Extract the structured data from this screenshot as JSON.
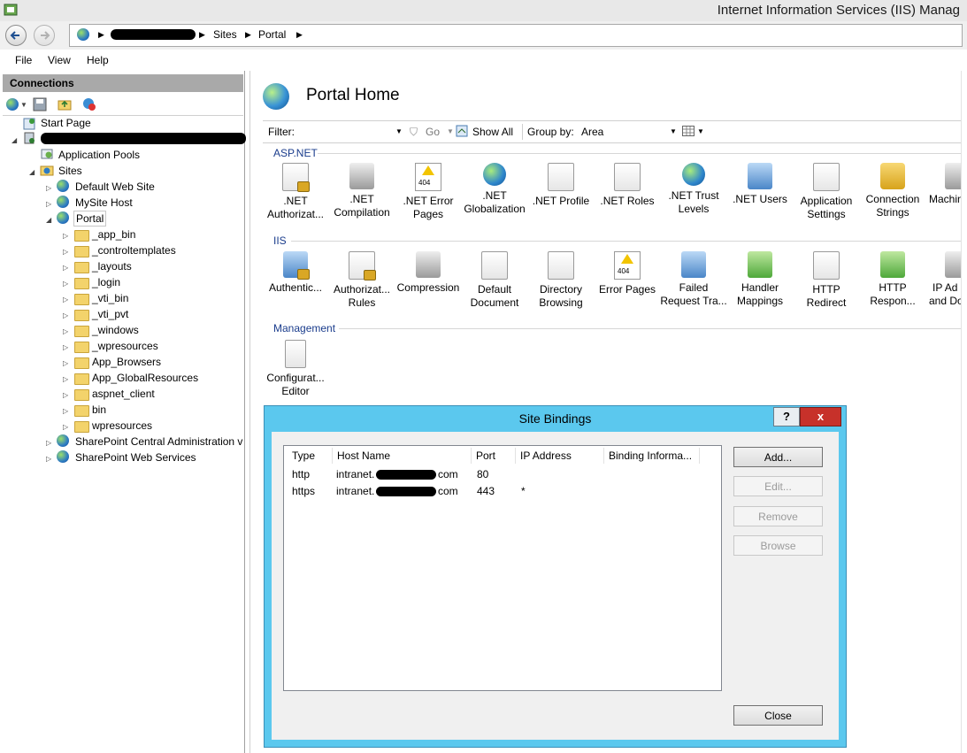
{
  "window": {
    "title": "Internet Information Services (IIS) Manag"
  },
  "address": {
    "segments": [
      "Sites",
      "Portal"
    ]
  },
  "menu": [
    "File",
    "View",
    "Help"
  ],
  "connections": {
    "header": "Connections",
    "tree": {
      "start_page": "Start Page",
      "app_pools": "Application Pools",
      "sites": "Sites",
      "site_list": [
        "Default Web Site",
        "MySite Host",
        "Portal"
      ],
      "portal_children": [
        "_app_bin",
        "_controltemplates",
        "_layouts",
        "_login",
        "_vti_bin",
        "_vti_pvt",
        "_windows",
        "_wpresources",
        "App_Browsers",
        "App_GlobalResources",
        "aspnet_client",
        "bin",
        "wpresources"
      ],
      "more_sites": [
        "SharePoint Central Administration v",
        "SharePoint Web Services"
      ]
    }
  },
  "main": {
    "title": "Portal Home",
    "filter": {
      "label": "Filter:",
      "go": "Go",
      "show_all": "Show All",
      "group_by_label": "Group by:",
      "group_by_value": "Area"
    },
    "groups": {
      "aspnet": {
        "label": "ASP.NET",
        "features": [
          {
            "l1": ".NET",
            "l2": "Authorizat..."
          },
          {
            "l1": ".NET",
            "l2": "Compilation"
          },
          {
            "l1": ".NET Error",
            "l2": "Pages"
          },
          {
            "l1": ".NET",
            "l2": "Globalization"
          },
          {
            "l1": ".NET Profile",
            "l2": ""
          },
          {
            "l1": ".NET Roles",
            "l2": ""
          },
          {
            "l1": ".NET Trust",
            "l2": "Levels"
          },
          {
            "l1": ".NET Users",
            "l2": ""
          },
          {
            "l1": "Application",
            "l2": "Settings"
          },
          {
            "l1": "Connection",
            "l2": "Strings"
          },
          {
            "l1": "Machin",
            "l2": ""
          }
        ]
      },
      "iis": {
        "label": "IIS",
        "features": [
          {
            "l1": "Authentic...",
            "l2": ""
          },
          {
            "l1": "Authorizat...",
            "l2": "Rules"
          },
          {
            "l1": "Compression",
            "l2": ""
          },
          {
            "l1": "Default",
            "l2": "Document"
          },
          {
            "l1": "Directory",
            "l2": "Browsing"
          },
          {
            "l1": "Error Pages",
            "l2": ""
          },
          {
            "l1": "Failed",
            "l2": "Request Tra..."
          },
          {
            "l1": "Handler",
            "l2": "Mappings"
          },
          {
            "l1": "HTTP",
            "l2": "Redirect"
          },
          {
            "l1": "HTTP",
            "l2": "Respon..."
          },
          {
            "l1": "IP Ad",
            "l2": "and Do"
          }
        ]
      },
      "management": {
        "label": "Management",
        "features": [
          {
            "l1": "Configurat...",
            "l2": "Editor"
          }
        ]
      }
    }
  },
  "dialog": {
    "title": "Site Bindings",
    "help": "?",
    "close_x": "x",
    "columns": [
      "Type",
      "Host Name",
      "Port",
      "IP Address",
      "Binding Informa..."
    ],
    "rows": [
      {
        "type": "http",
        "host_prefix": "intranet.",
        "host_suffix": "com",
        "port": "80",
        "ip": ""
      },
      {
        "type": "https",
        "host_prefix": "intranet.",
        "host_suffix": "com",
        "port": "443",
        "ip": "*"
      }
    ],
    "buttons": {
      "add": "Add...",
      "edit": "Edit...",
      "remove": "Remove",
      "browse": "Browse",
      "close": "Close"
    }
  }
}
